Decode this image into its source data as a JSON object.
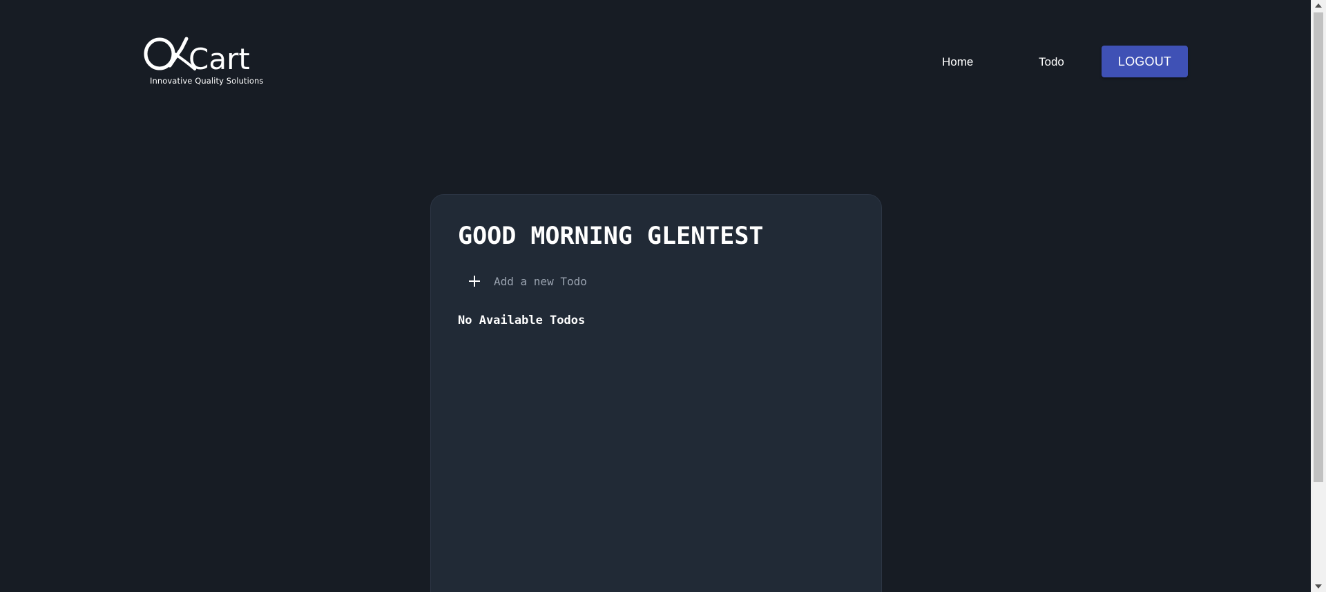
{
  "header": {
    "logo_tagline": "Innovative Quality Solutions",
    "nav": {
      "home_label": "Home",
      "todo_label": "Todo",
      "logout_label": "LOGOUT"
    }
  },
  "card": {
    "greeting": "GOOD MORNING GLENTEST",
    "add_todo_placeholder": "Add a new Todo",
    "empty_message": "No Available Todos"
  },
  "colors": {
    "background": "#171c24",
    "card": "#212a36",
    "accent": "#3f51b5"
  },
  "icons": {
    "logo": "qkart-logo",
    "add": "plus-icon"
  }
}
